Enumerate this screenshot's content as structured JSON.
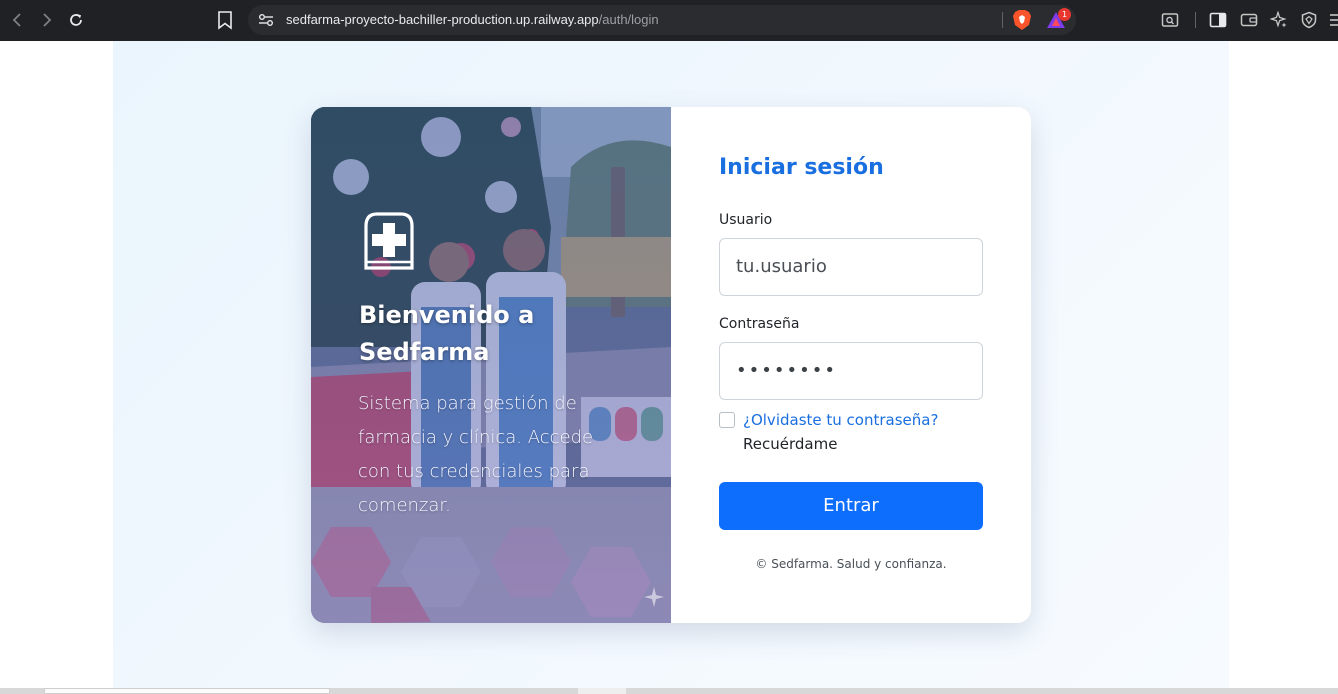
{
  "browser": {
    "url_host": "sedfarma-proyecto-bachiller-production.up.railway.app",
    "url_path": "/auth/login",
    "rewards_badge_count": "1",
    "icons": [
      "back-icon",
      "forward-icon",
      "reload-icon",
      "bookmark-icon",
      "site-settings-icon",
      "brave-shields-icon",
      "brave-rewards-icon",
      "screenshot-search-icon",
      "sidebar-icon",
      "wallet-icon",
      "leo-ai-icon",
      "vpn-icon",
      "menu-icon"
    ]
  },
  "hero": {
    "title": "Bienvenido a Sedfarma",
    "description": "Sistema para gestión de farmacia y clínica. Accede con tus credenciales para comenzar.",
    "logo_icon": "pharmacy-cross-icon"
  },
  "login": {
    "title": "Iniciar sesión",
    "username_label": "Usuario",
    "username_value": "tu.usuario",
    "password_label": "Contraseña",
    "password_value": "••••••••",
    "forgot_link": "¿Olvidaste tu contraseña?",
    "remember_label": "Recuérdame",
    "remember_checked": false,
    "submit_label": "Entrar",
    "footer": "© Sedfarma. Salud y confianza."
  },
  "colors": {
    "primary": "#0d6efd",
    "title_blue": "#1a6fe0",
    "page_background": "#eef7fd"
  }
}
